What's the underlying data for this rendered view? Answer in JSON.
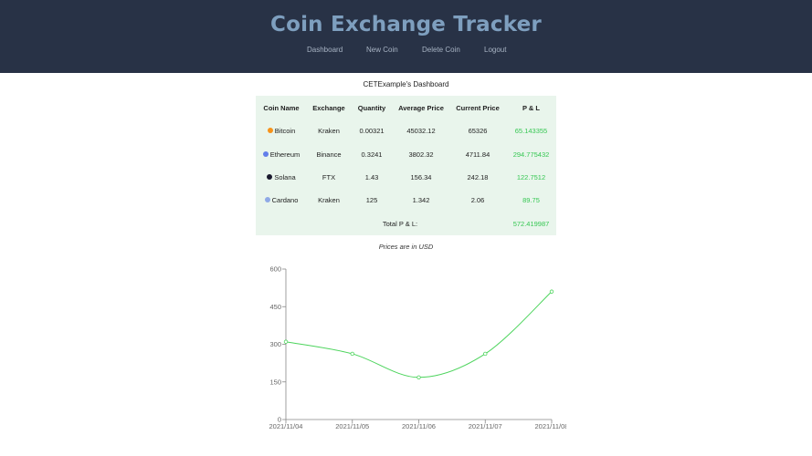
{
  "header": {
    "title": "Coin Exchange Tracker",
    "nav": [
      "Dashboard",
      "New Coin",
      "Delete Coin",
      "Logout"
    ]
  },
  "dashboard": {
    "title": "CETExample's Dashboard",
    "columns": [
      "Coin Name",
      "Exchange",
      "Quantity",
      "Average Price",
      "Current Price",
      "P & L"
    ],
    "rows": [
      {
        "icon": "bitcoin-icon",
        "icon_color": "#f7931a",
        "name": "Bitcoin",
        "exchange": "Kraken",
        "quantity": "0.00321",
        "avg_price": "45032.12",
        "current_price": "65326",
        "pl": "65.143355"
      },
      {
        "icon": "ethereum-icon",
        "icon_color": "#627eea",
        "name": "Ethereum",
        "exchange": "Binance",
        "quantity": "0.3241",
        "avg_price": "3802.32",
        "current_price": "4711.84",
        "pl": "294.775432"
      },
      {
        "icon": "solana-icon",
        "icon_color": "#1a1a2e",
        "name": "Solana",
        "exchange": "FTX",
        "quantity": "1.43",
        "avg_price": "156.34",
        "current_price": "242.18",
        "pl": "122.7512"
      },
      {
        "icon": "cardano-icon",
        "icon_color": "#8fa9e6",
        "name": "Cardano",
        "exchange": "Kraken",
        "quantity": "125",
        "avg_price": "1.342",
        "current_price": "2.06",
        "pl": "89.75"
      }
    ],
    "total_label": "Total P & L:",
    "total_value": "572.419987",
    "note": "Prices are in USD"
  },
  "colors": {
    "header_bg": "#283246",
    "title": "#7e9fbf",
    "table_bg": "#e9f5ec",
    "positive": "#35c752",
    "line": "#4cd45c"
  },
  "chart_data": {
    "type": "line",
    "x": [
      "2021/11/04",
      "2021/11/05",
      "2021/11/06",
      "2021/11/07",
      "2021/11/08"
    ],
    "series": [
      {
        "values": [
          310,
          262,
          168,
          262,
          510
        ]
      }
    ],
    "yticks": [
      0,
      150,
      300,
      450,
      600
    ],
    "ylim": [
      0,
      600
    ],
    "grid": false,
    "legend": "none"
  }
}
